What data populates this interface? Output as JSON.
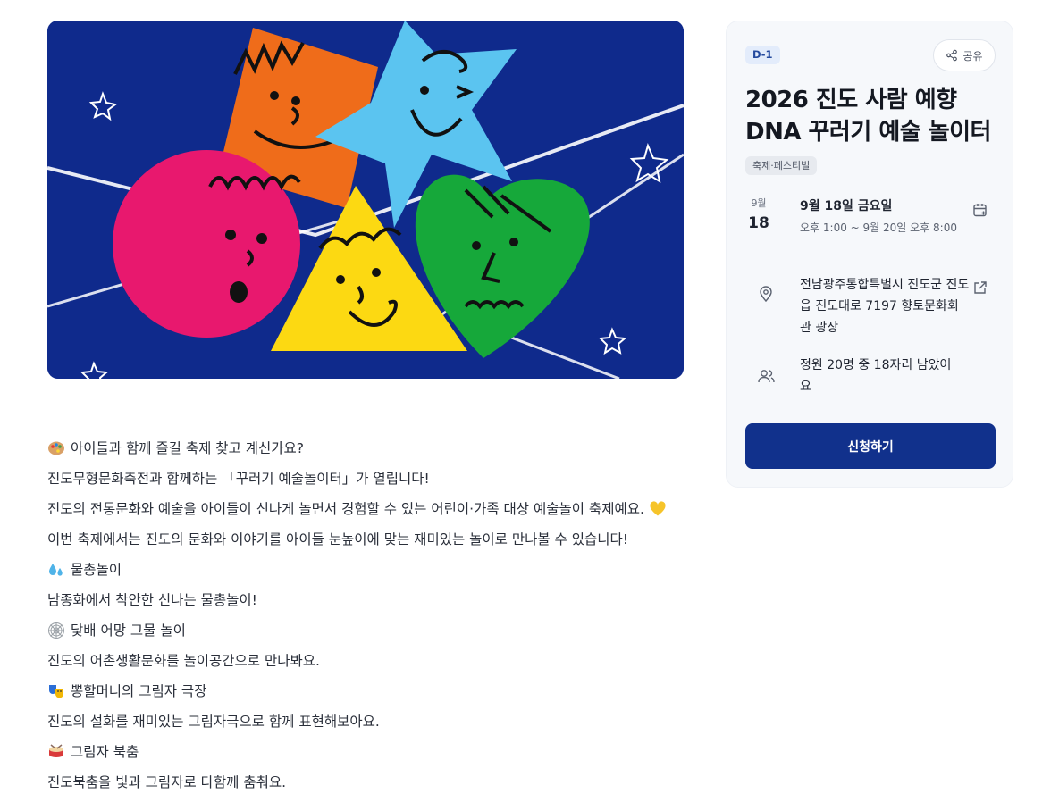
{
  "event": {
    "dday": "D-1",
    "share_label": "공유",
    "title": "2026 진도 사람 예향 DNA 꾸러기 예술 놀이터",
    "category": "축제·페스티벌",
    "date_month": "9월",
    "date_day": "18",
    "date_main": "9월 18일 금요일",
    "date_sub": "오후 1:00 ~ 9월 20일 오후 8:00",
    "address": "전남광주통합특별시 진도군 진도읍 진도대로 7197 향토문화회관 광장",
    "capacity": "정원 20명 중 18자리 남았어요",
    "apply_label": "신청하기"
  },
  "description": [
    {
      "emoji": "palette-icon",
      "text": "아이들과 함께 즐길 축제 찾고 계신가요?"
    },
    {
      "emoji": "",
      "text": "진도무형문화축전과 함께하는 「꾸러기 예술놀이터」가 열립니다!"
    },
    {
      "emoji": "",
      "text": "진도의 전통문화와 예술을 아이들이 신나게 놀면서 경험할 수 있는 어린이·가족 대상 예술놀이 축제예요.",
      "tail_emoji": "yellow-heart-icon"
    },
    {
      "emoji": "",
      "text": "이번 축제에서는 진도의 문화와 이야기를 아이들 눈높이에 맞는 재미있는 놀이로 만나볼 수 있습니다!"
    },
    {
      "emoji": "water-drops-icon",
      "text": "물총놀이"
    },
    {
      "emoji": "",
      "text": "남종화에서 착안한 신나는 물총놀이!"
    },
    {
      "emoji": "spiderweb-icon",
      "text": "닻배 어망 그물 놀이"
    },
    {
      "emoji": "",
      "text": "진도의 어촌생활문화를 놀이공간으로 만나봐요."
    },
    {
      "emoji": "theater-masks-icon",
      "text": "뽕할머니의 그림자 극장"
    },
    {
      "emoji": "",
      "text": "진도의 설화를 재미있는 그림자극으로 함께 표현해보아요."
    },
    {
      "emoji": "drum-icon",
      "text": "그림자 북춤"
    },
    {
      "emoji": "",
      "text": "진도북춤을 빛과 그림자로 다함께 춤춰요."
    }
  ],
  "colors": {
    "hero_bg": "#0f2a8c",
    "button": "#11318c",
    "square": "#ef6c1a",
    "star": "#5bc4f0",
    "circle": "#e8186e",
    "triangle": "#fcd912",
    "heart": "#16a83a"
  }
}
